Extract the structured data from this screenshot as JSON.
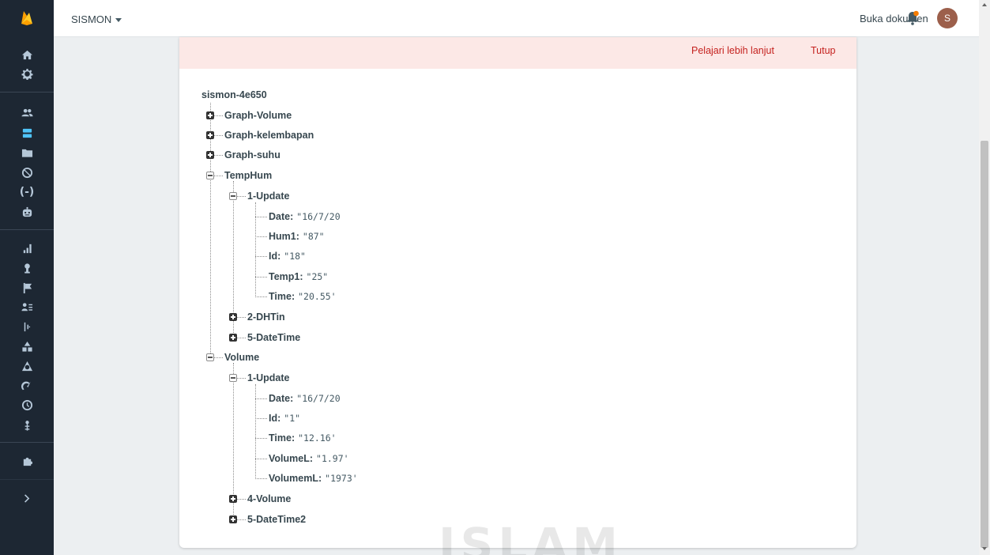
{
  "header": {
    "project_name": "SISMON",
    "docs_label": "Buka dokumen",
    "avatar_initial": "S"
  },
  "banner": {
    "learn_more": "Pelajari lebih lanjut",
    "close": "Tutup"
  },
  "watermark_text": "ISLAM",
  "colors": {
    "sidebar_bg": "#1d2733",
    "sidebar_icon": "#b5c7d8",
    "sidebar_active": "#4fc3f7",
    "banner_bg": "#fce8e6",
    "banner_link": "#c5221f",
    "avatar_bg": "#9c5f4b",
    "bell_color": "#f57c00"
  },
  "sidebar": {
    "icons": [
      "home-icon",
      "settings-icon",
      "users-icon",
      "database-icon",
      "storage-icon",
      "hosting-icon",
      "functions-icon",
      "ml-icon",
      "analytics-icon",
      "predictions-icon",
      "ab-testing-icon",
      "cloud-messaging-icon",
      "remote-config-icon",
      "dynamic-links-icon",
      "crashlytics-icon",
      "performance-icon",
      "test-lab-icon",
      "app-distribution-icon",
      "extensions-icon",
      "expand-icon"
    ]
  },
  "tree": {
    "root": "sismon-4e650",
    "graph_volume": "Graph-Volume",
    "graph_kelembapan": "Graph-kelembapan",
    "graph_suhu": "Graph-suhu",
    "temphum": {
      "key": "TempHum",
      "update": {
        "key": "1-Update",
        "date_key": "Date:",
        "date_val": "\"16/7/20",
        "hum_key": "Hum1:",
        "hum_val": "\"87\"",
        "id_key": "Id:",
        "id_val": "\"18\"",
        "temp_key": "Temp1:",
        "temp_val": "\"25\"",
        "time_key": "Time:",
        "time_val": "\"20.55'"
      },
      "dhtin": "2-DHTin",
      "datetime": "5-DateTime"
    },
    "volume": {
      "key": "Volume",
      "update": {
        "key": "1-Update",
        "date_key": "Date:",
        "date_val": "\"16/7/20",
        "id_key": "Id:",
        "id_val": "\"1\"",
        "time_key": "Time:",
        "time_val": "\"12.16'",
        "vl_key": "VolumeL:",
        "vl_val": "\"1.97'",
        "vml_key": "VolumemL:",
        "vml_val": "\"1973'"
      },
      "vol4": "4-Volume",
      "datetime2": "5-DateTime2"
    }
  }
}
